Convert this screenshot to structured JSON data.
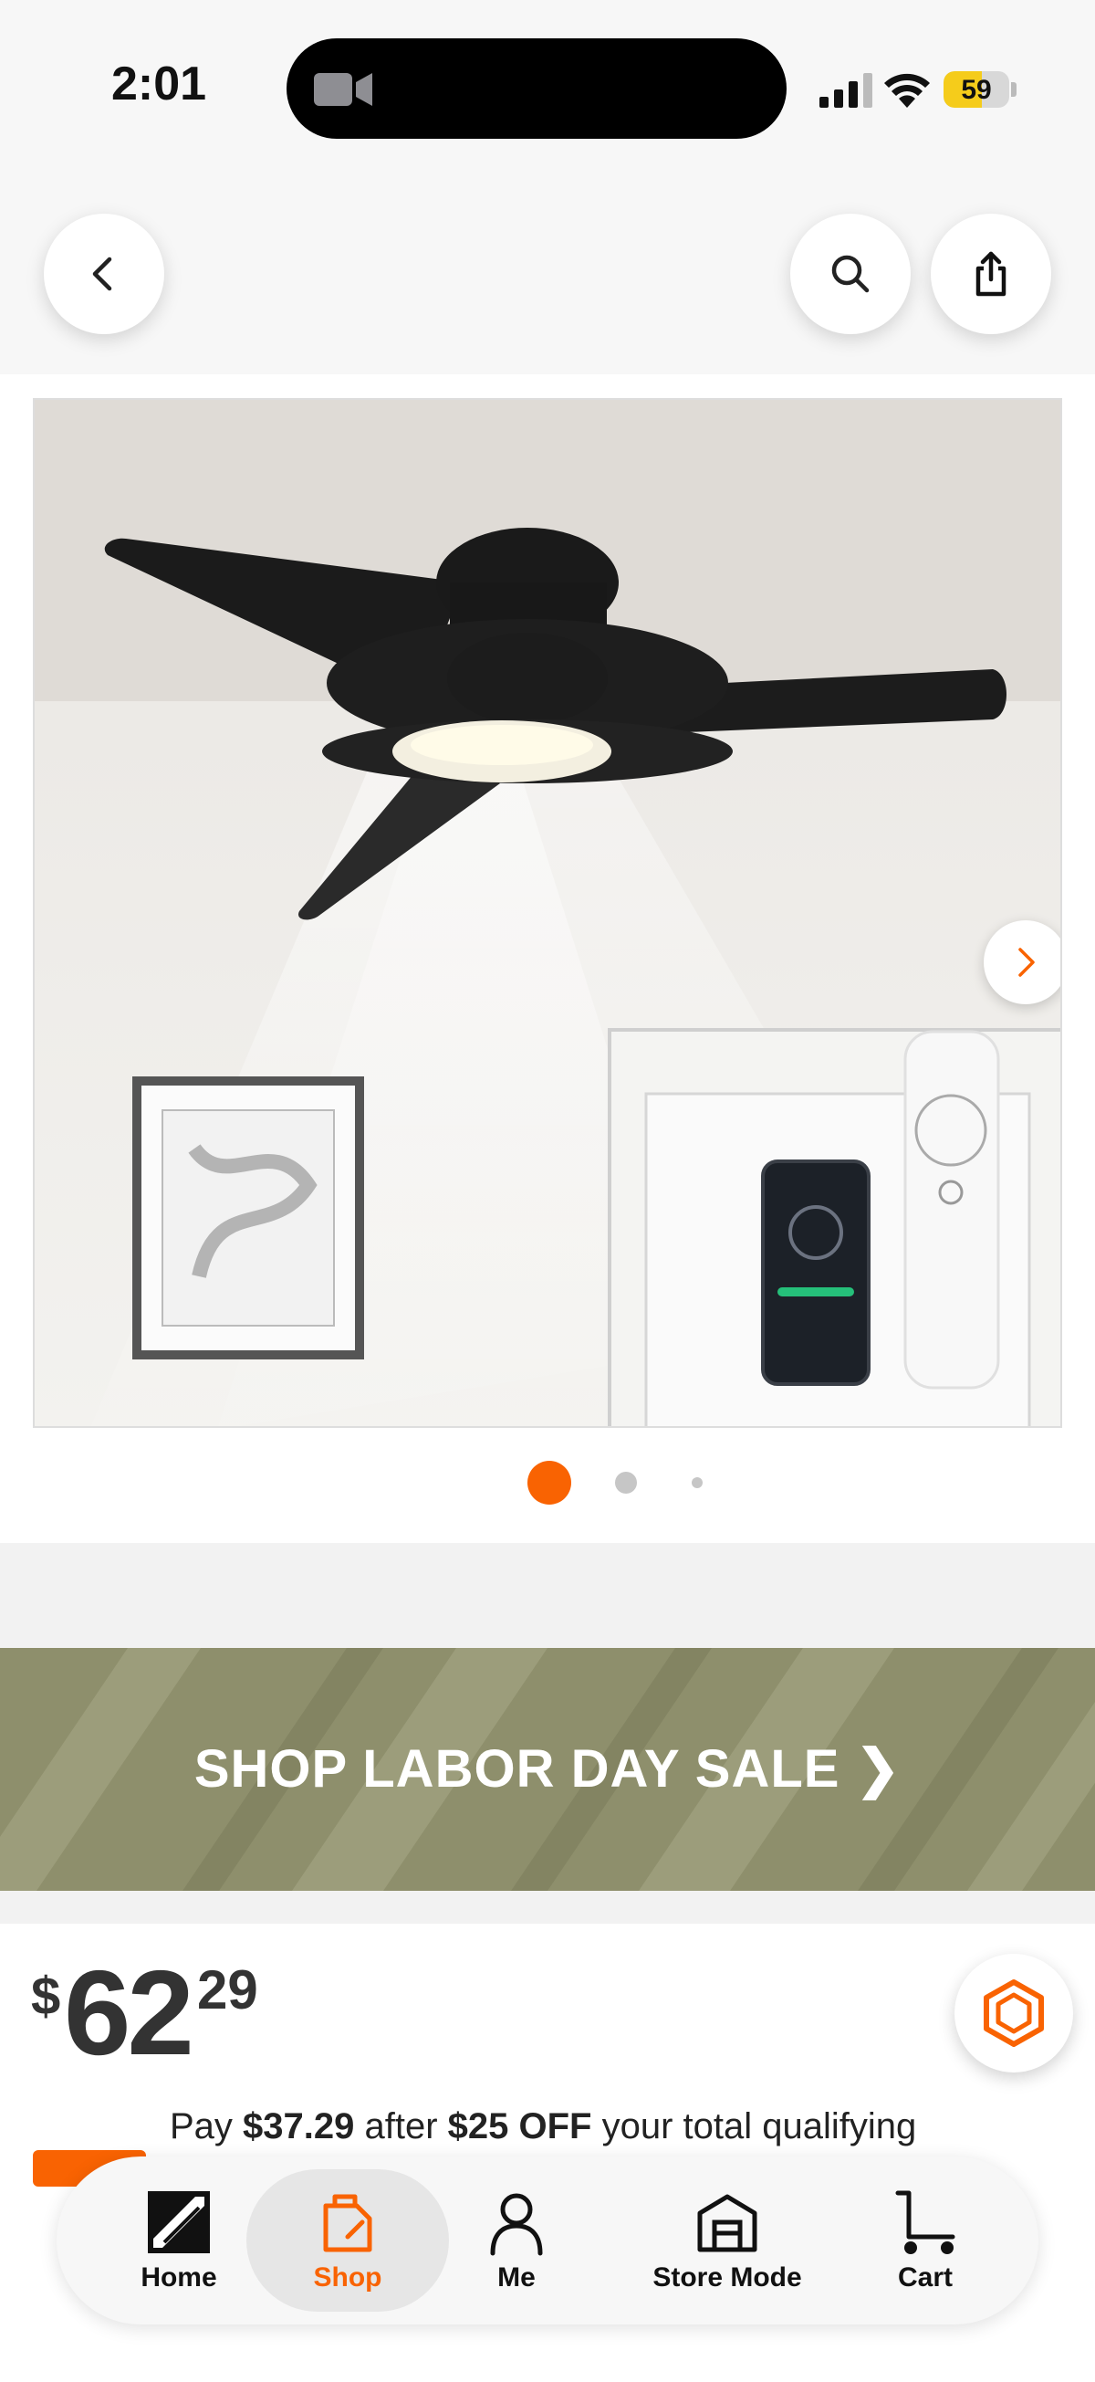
{
  "status_bar": {
    "time": "2:01",
    "battery_percent": "59",
    "battery_level": 0.59,
    "colors": {
      "battery_fill": "#f5cc1b"
    }
  },
  "header": {
    "back_icon": "chevron-left-icon",
    "search_icon": "search-icon",
    "share_icon": "share-icon"
  },
  "gallery": {
    "image_count": 3,
    "current_index": 0,
    "next_icon": "chevron-right-icon"
  },
  "banner": {
    "text": "SHOP LABOR DAY SALE ❯"
  },
  "price": {
    "symbol": "$",
    "dollars": "62",
    "cents": "29"
  },
  "promo": {
    "prefix": "Pay ",
    "amount": "$37.29",
    "middle": " after ",
    "discount": "$25 OFF",
    "suffix": " your total qualifying"
  },
  "bottom_nav": {
    "items": [
      {
        "label": "Home",
        "icon": "home-depot-logo-icon",
        "active": false
      },
      {
        "label": "Shop",
        "icon": "shop-bag-icon",
        "active": true
      },
      {
        "label": "Me",
        "icon": "user-icon",
        "active": false
      },
      {
        "label": "Store Mode",
        "icon": "store-icon",
        "active": false
      },
      {
        "label": "Cart",
        "icon": "cart-icon",
        "active": false
      }
    ]
  },
  "colors": {
    "brand_orange": "#f96302",
    "banner_green": "#8e8f6c"
  }
}
